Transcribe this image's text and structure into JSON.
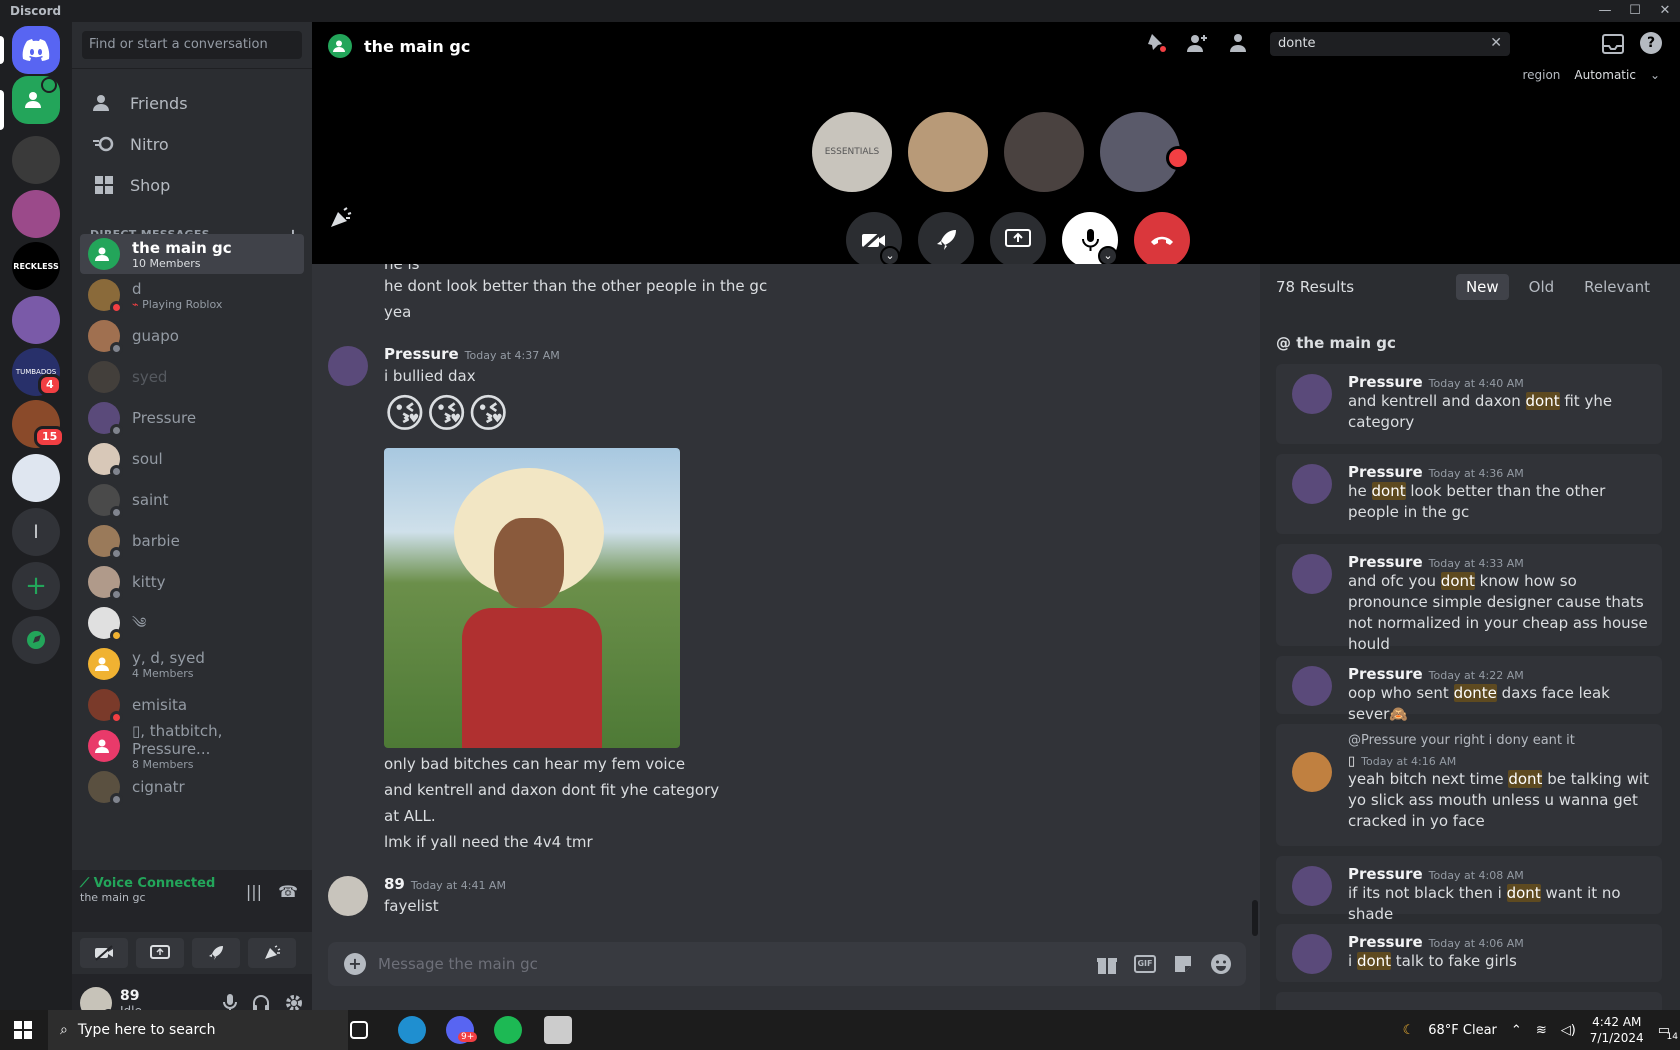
{
  "app": {
    "title": "Discord"
  },
  "window_controls": {
    "minimize": "—",
    "maximize": "☐",
    "close": "✕"
  },
  "guild_badges": {
    "tumbados": "4",
    "server7": "15"
  },
  "dm_sidebar": {
    "search_placeholder": "Find or start a conversation",
    "nav": [
      {
        "label": "Friends"
      },
      {
        "label": "Nitro"
      },
      {
        "label": "Shop"
      }
    ],
    "header": "DIRECT MESSAGES",
    "add": "+",
    "dms": [
      {
        "name": "the main gc",
        "sub": "10 Members"
      },
      {
        "name": "d",
        "sub": "Playing Roblox"
      },
      {
        "name": "guapo",
        "sub": ""
      },
      {
        "name": "syed",
        "sub": ""
      },
      {
        "name": "Pressure",
        "sub": ""
      },
      {
        "name": "soul",
        "sub": ""
      },
      {
        "name": "saint",
        "sub": ""
      },
      {
        "name": "barbie",
        "sub": ""
      },
      {
        "name": "kitty",
        "sub": ""
      },
      {
        "name": "༄",
        "sub": ""
      },
      {
        "name": "y, d, syed",
        "sub": "4 Members"
      },
      {
        "name": "emisita",
        "sub": ""
      },
      {
        "name": "▯, thatbitch, Pressure...",
        "sub": "8 Members"
      },
      {
        "name": "cignatr",
        "sub": ""
      }
    ],
    "voice": {
      "status": "Voice Connected",
      "channel": "the main gc"
    },
    "user": {
      "name": "89",
      "status": "Idle"
    }
  },
  "call": {
    "title": "the main gc",
    "search_value": "donte",
    "region_label": "region",
    "region_value": "Automatic"
  },
  "chat": {
    "partial": "he is",
    "lines_top": [
      "he dont look better than the other people in the gc",
      "yea"
    ],
    "msg1": {
      "author": "Pressure",
      "time": "Today at 4:37 AM",
      "text": "i bullied dax",
      "emoji": "😘😘😘",
      "more": [
        "only bad bitches can hear my fem voice",
        "and kentrell and daxon dont fit yhe category",
        "at ALL.",
        "lmk if yall need the 4v4 tmr"
      ]
    },
    "msg2": {
      "author": "89",
      "time": "Today at 4:41 AM",
      "text": "fayelist"
    },
    "composer_placeholder": "Message the main gc"
  },
  "results": {
    "count": "78 Results",
    "tabs": [
      "New",
      "Old",
      "Relevant"
    ],
    "channel": "@ the main gc",
    "items": [
      {
        "author": "Pressure",
        "time": "Today at 4:40 AM",
        "pre": "and kentrell and daxon ",
        "hl": "dont",
        "post": " fit yhe category"
      },
      {
        "author": "Pressure",
        "time": "Today at 4:36 AM",
        "pre": "he ",
        "hl": "dont",
        "post": " look better than the other people in the gc"
      },
      {
        "author": "Pressure",
        "time": "Today at 4:33 AM",
        "pre": "and ofc you ",
        "hl": "dont",
        "post": " know how so pronounce simple designer cause thats not normalized in your cheap ass house hould"
      },
      {
        "author": "Pressure",
        "time": "Today at 4:22 AM",
        "pre": "oop who sent ",
        "hl": "donte",
        "post": " daxs face leak sever🙈"
      },
      {
        "author": "▯",
        "time": "Today at 4:16 AM",
        "reply": "@Pressure your right i dony eant it",
        "pre": "yeah bitch next time ",
        "hl": "dont",
        "post": " be talking wit yo slick ass mouth unless u wanna get cracked in yo face"
      },
      {
        "author": "Pressure",
        "time": "Today at 4:08 AM",
        "pre": "if its not black then i ",
        "hl": "dont",
        "post": " want it no shade"
      },
      {
        "author": "Pressure",
        "time": "Today at 4:06 AM",
        "pre": "i ",
        "hl": "dont",
        "post": " talk to fake girls"
      }
    ]
  },
  "taskbar": {
    "search_placeholder": "Type here to search",
    "discord_badge": "9+",
    "weather": "68°F  Clear",
    "time": "4:42 AM",
    "date": "7/1/2024",
    "notif_count": "14"
  },
  "colors": {
    "green": "#23a55a",
    "red": "#f23f43",
    "blurple": "#5865f2"
  }
}
